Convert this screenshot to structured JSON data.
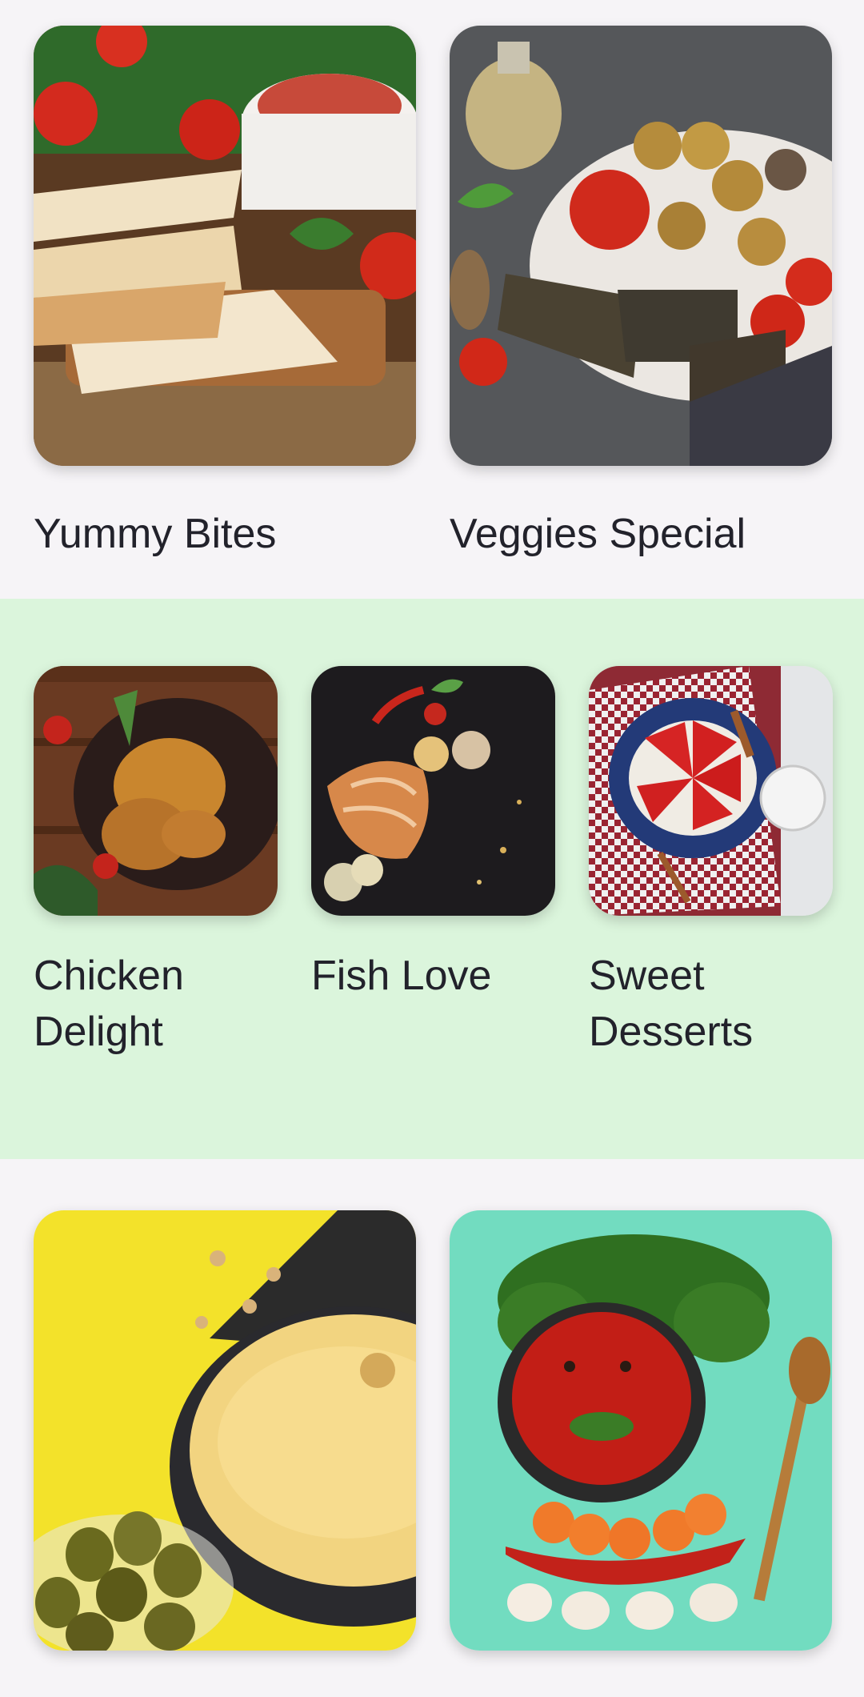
{
  "sections": [
    {
      "cards": [
        {
          "label": "Yummy Bites",
          "image": "quesadilla-photo"
        },
        {
          "label": "Veggies Special",
          "image": "grilled-vegetables-photo"
        }
      ]
    },
    {
      "background": "#dbf5dc",
      "cards": [
        {
          "label": "Chicken\nDelight",
          "image": "roast-chicken-photo"
        },
        {
          "label": "Fish Love",
          "image": "grilled-salmon-photo"
        },
        {
          "label": "Sweet\nDesserts",
          "image": "cheesecake-photo"
        }
      ]
    },
    {
      "cards": [
        {
          "label": "",
          "image": "hummus-olives-photo"
        },
        {
          "label": "",
          "image": "tomato-soup-photo"
        }
      ]
    }
  ],
  "colors": {
    "page_bg": "#f6f4f7",
    "highlight_bg": "#dbf5dc",
    "text": "#22222b"
  }
}
